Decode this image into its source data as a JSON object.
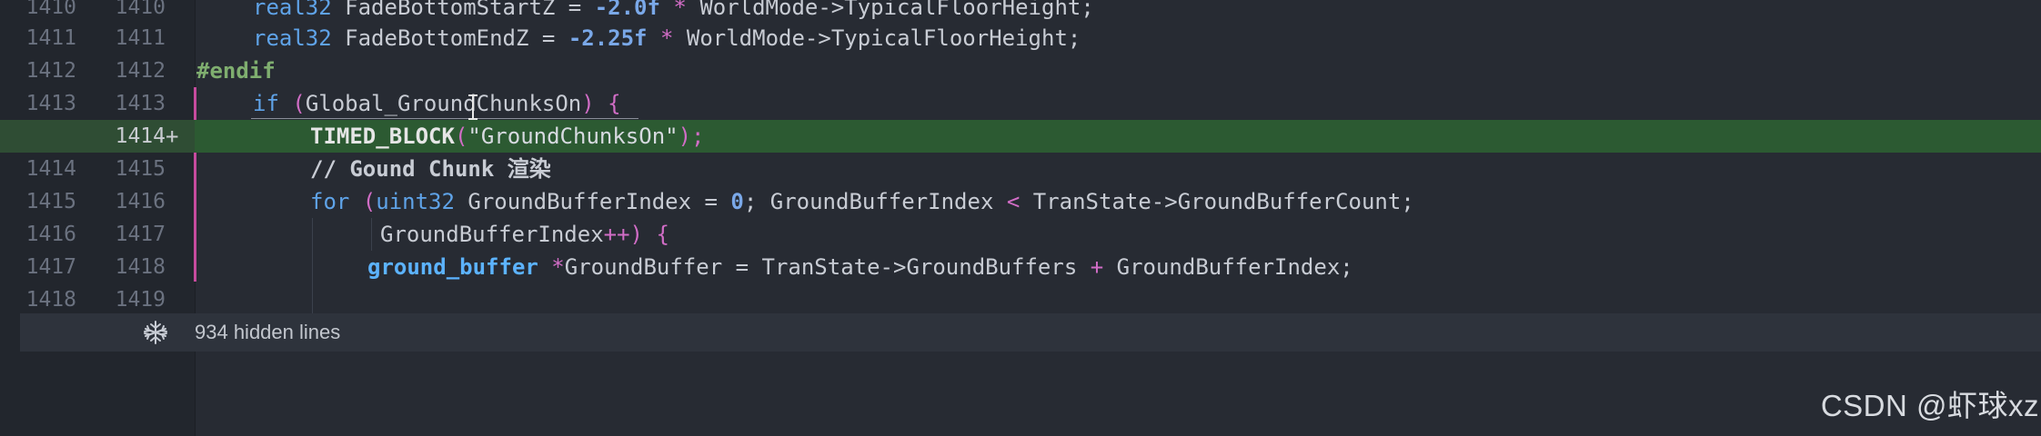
{
  "editor": {
    "lines": [
      {
        "old": "1410",
        "new": "1410",
        "added": false
      },
      {
        "old": "1411",
        "new": "1411",
        "added": false
      },
      {
        "old": "1412",
        "new": "1412",
        "added": false
      },
      {
        "old": "1413",
        "new": "1413",
        "added": false
      },
      {
        "old": "",
        "new": "1414",
        "added": true,
        "marker": "+"
      },
      {
        "old": "1414",
        "new": "1415",
        "added": false
      },
      {
        "old": "1415",
        "new": "1416",
        "added": false
      },
      {
        "old": "1416",
        "new": "1417",
        "added": false
      },
      {
        "old": "1417",
        "new": "1418",
        "added": false
      },
      {
        "old": "1418",
        "new": "1419",
        "added": false
      }
    ],
    "code": {
      "l0": {
        "t1": "real32 ",
        "t2": "FadeBottomStartZ ",
        "t3": "= ",
        "t4": "-2.0f",
        "t5": " * ",
        "t6": "WorldMode->TypicalFloorHeight;"
      },
      "l1": {
        "t1": "real32 ",
        "t2": "FadeBottomEndZ ",
        "t3": "= ",
        "t4": "-2.25f",
        "t5": " * ",
        "t6": "WorldMode->TypicalFloorHeight;"
      },
      "l2": {
        "t1": "#endif"
      },
      "l3": {
        "t1": "if ",
        "t2": "(",
        "t3": "Global_GroundChunksOn",
        "t4": ") {"
      },
      "l4": {
        "t1": "TIMED_BLOCK",
        "t2": "(",
        "t3": "\"GroundChunksOn\"",
        "t4": ");"
      },
      "l5": {
        "t1": "// Gound Chunk ",
        "t2": "渲染"
      },
      "l6": {
        "t1": "for ",
        "t2": "(",
        "t3": "uint32 ",
        "t4": "GroundBufferIndex ",
        "t5": "= ",
        "t6": "0",
        "t7": "; GroundBufferIndex ",
        "t8": "<",
        "t9": " TranState->GroundBufferCount;"
      },
      "l7": {
        "t1": "GroundBufferIndex",
        "t2": "++",
        "t3": ") {"
      },
      "l8": {
        "t1": "ground_buffer ",
        "t2": "*",
        "t3": "GroundBuffer ",
        "t4": "= ",
        "t5": "TranState->GroundBuffers ",
        "t6": "+",
        "t7": " GroundBufferIndex;"
      }
    }
  },
  "hidden_bar": {
    "label": "934 hidden lines",
    "icon": "unfold-icon"
  },
  "watermark": "CSDN @虾球xz",
  "colors": {
    "background": "#272b33",
    "gutter": "#22262d",
    "added_line": "#2c5a32",
    "change_bar": "#c74b9e",
    "keyword": "#5fa3e8",
    "preprocessor": "#7fae6f"
  }
}
